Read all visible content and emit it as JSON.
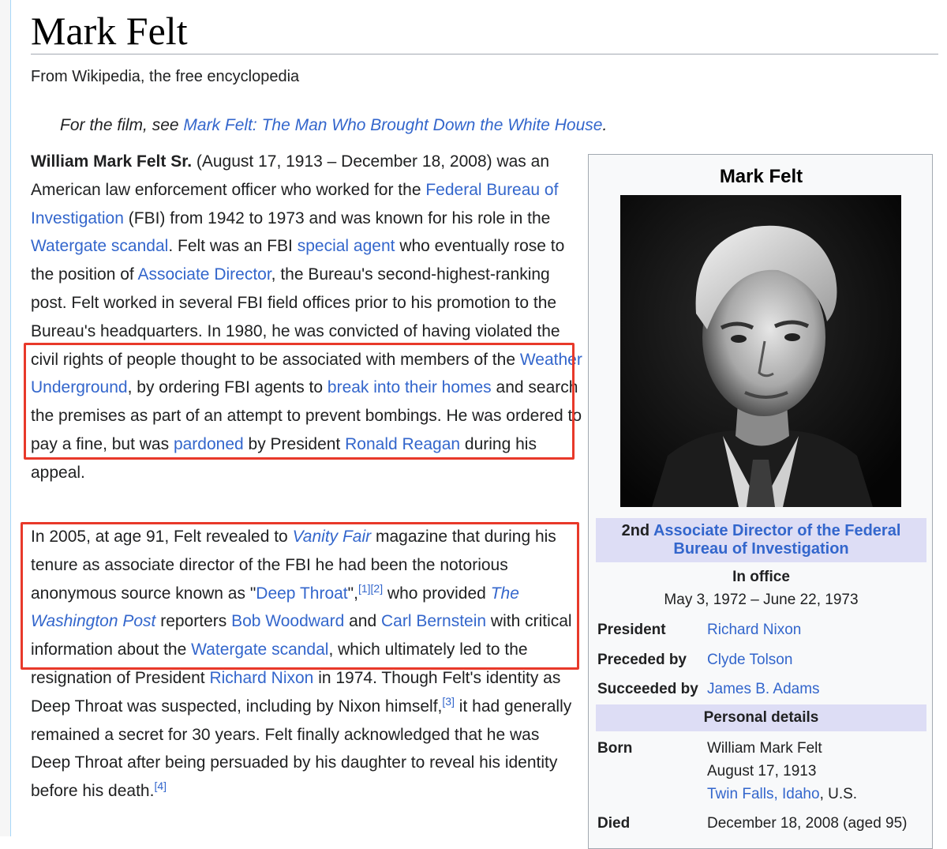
{
  "article": {
    "title": "Mark Felt",
    "tagline": "From Wikipedia, the free encyclopedia",
    "hatnote": {
      "prefix": "For the film, see ",
      "link": "Mark Felt: The Man Who Brought Down the White House",
      "suffix": "."
    },
    "p1": {
      "lead_bold": "William Mark Felt Sr.",
      "t1": " (August 17, 1913 – December 18, 2008) was an American law enforcement officer who worked for the ",
      "l1": "Federal Bureau of Investigation",
      "t2": " (FBI) from 1942 to 1973 and was known for his role in the ",
      "l2": "Watergate scandal",
      "t3": ". Felt was an FBI ",
      "l3": "special agent",
      "t4": " who eventually rose to the position of ",
      "l4": "Associate Director",
      "t5": ", the Bureau's second-highest-ranking post. Felt worked in several FBI field offices prior to his promotion to the Bureau's headquarters. In 1980, he was convicted of having violated the civil rights of people thought to be associated with members of the ",
      "l5": "Weather Underground",
      "t6": ", by ordering FBI agents to ",
      "l6": "break into their homes",
      "t7": " and search the premises as part of an attempt to prevent bombings. He was ordered to pay a fine, but was ",
      "l7": "pardoned",
      "t8": " by President ",
      "l8": "Ronald Reagan",
      "t9": " during his appeal."
    },
    "p2": {
      "t1": "In 2005, at age 91, Felt revealed to ",
      "l1": "Vanity Fair",
      "t2": " magazine that during his tenure as associate director of the FBI he had been the notorious anonymous source known as \"",
      "l2": "Deep Throat",
      "t3": "\",",
      "ref1": "[1]",
      "ref2": "[2]",
      "t4": " who provided ",
      "l3": "The Washington Post",
      "t5": " reporters ",
      "l4": "Bob Woodward",
      "t6": " and ",
      "l5": "Carl Bernstein",
      "t7": " with critical information about the ",
      "l6": "Watergate scandal",
      "t8": ", which ultimately led to the resignation of President ",
      "l7": "Richard Nixon",
      "t9": " in 1974. Though Felt's identity as Deep Throat was suspected, including by Nixon himself,",
      "ref3": "[3]",
      "t10": " it had generally remained a secret for 30 years. Felt finally acknowledged that he was Deep Throat after being persuaded by his daughter to reveal his identity before his death.",
      "ref4": "[4]"
    }
  },
  "infobox": {
    "title": "Mark Felt",
    "office_prefix": "2nd ",
    "office_link": "Associate Director of the Federal Bureau of Investigation",
    "in_office_label": "In office",
    "in_office_dates": "May 3, 1972 – June 22, 1973",
    "rows": [
      {
        "label": "President",
        "value": "Richard Nixon"
      },
      {
        "label": "Preceded by",
        "value": "Clyde Tolson"
      },
      {
        "label": "Succeeded by",
        "value": "James B. Adams"
      }
    ],
    "personal_header": "Personal details",
    "born_label": "Born",
    "born_name": "William Mark Felt",
    "born_date": "August 17, 1913",
    "born_place_link": "Twin Falls, Idaho",
    "born_place_suffix": ", U.S.",
    "died_label": "Died",
    "died_value": "December 18, 2008 (aged 95)"
  },
  "colors": {
    "link": "#3366cc",
    "highlight_box": "#e8392a",
    "infobox_header_bg": "#ddddf5"
  }
}
